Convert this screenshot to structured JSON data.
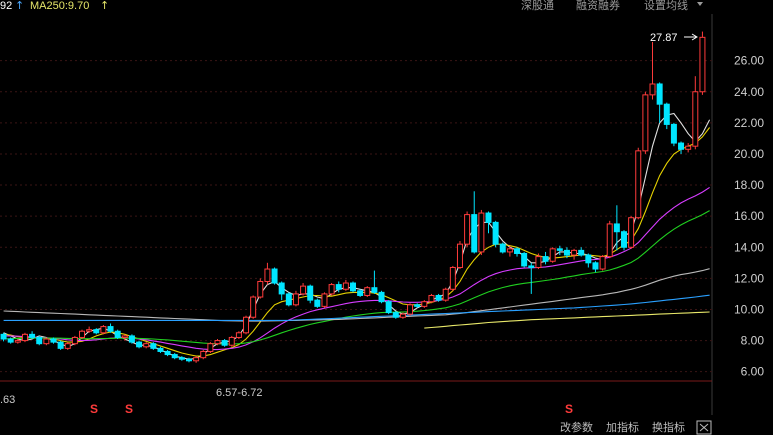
{
  "header": {
    "ma_left": "92",
    "ma_left_arrow": "↑",
    "ma250_label": "MA250:9.70",
    "ma250_arrow": "↑",
    "buttons": [
      "深股通",
      "融资融券",
      "设置均线"
    ]
  },
  "annotations": {
    "peak": "27.87",
    "low_range": "6.57-6.72",
    "left_value": ".63",
    "s_markers": [
      "S",
      "S",
      "S"
    ]
  },
  "footer": {
    "buttons": [
      "改参数",
      "加指标",
      "换指标"
    ]
  },
  "colors": {
    "up": "#ff3b3b",
    "down": "#00e5ff",
    "ma_white": "#e0e0e0",
    "ma_yellow": "#e6d200",
    "ma_purple": "#d63cff",
    "ma_green": "#20d020",
    "ma_gray": "#b8b8b8",
    "ma_cyan": "#2aa0ff",
    "ma_lightyellow": "#e8e86a"
  },
  "chart_data": {
    "type": "candlestick",
    "yaxis_ticks": [
      "26.00",
      "24.00",
      "22.00",
      "20.00",
      "18.00",
      "16.00",
      "14.00",
      "12.00",
      "10.00",
      "8.00",
      "6.00"
    ],
    "ylim": [
      5.4,
      29.0
    ],
    "candles": [
      [
        8.4,
        8.1,
        8.5,
        7.95
      ],
      [
        8.1,
        7.9,
        8.2,
        7.8
      ],
      [
        7.9,
        8.0,
        8.1,
        7.8
      ],
      [
        8.0,
        8.4,
        8.5,
        7.9
      ],
      [
        8.4,
        8.2,
        8.6,
        8.1
      ],
      [
        8.2,
        7.8,
        8.3,
        7.7
      ],
      [
        7.8,
        8.1,
        8.2,
        7.7
      ],
      [
        8.1,
        7.9,
        8.2,
        7.8
      ],
      [
        7.9,
        7.5,
        8.0,
        7.4
      ],
      [
        7.5,
        7.8,
        7.9,
        7.4
      ],
      [
        7.8,
        8.2,
        8.3,
        7.7
      ],
      [
        8.2,
        8.6,
        8.7,
        8.1
      ],
      [
        8.6,
        8.7,
        8.9,
        8.5
      ],
      [
        8.7,
        8.5,
        8.8,
        8.4
      ],
      [
        8.5,
        8.9,
        9.0,
        8.4
      ],
      [
        8.9,
        8.6,
        9.1,
        8.5
      ],
      [
        8.6,
        8.2,
        8.7,
        8.1
      ],
      [
        8.2,
        8.3,
        8.4,
        8.0
      ],
      [
        8.3,
        7.9,
        8.4,
        7.8
      ],
      [
        7.9,
        7.6,
        8.0,
        7.5
      ],
      [
        7.6,
        7.8,
        7.9,
        7.5
      ],
      [
        7.8,
        7.5,
        7.9,
        7.4
      ],
      [
        7.5,
        7.3,
        7.6,
        7.2
      ],
      [
        7.3,
        7.1,
        7.4,
        7.0
      ],
      [
        7.1,
        6.9,
        7.2,
        6.8
      ],
      [
        6.9,
        6.8,
        7.0,
        6.7
      ],
      [
        6.8,
        6.7,
        6.9,
        6.6
      ],
      [
        6.7,
        6.9,
        7.0,
        6.57
      ],
      [
        6.9,
        7.3,
        7.4,
        6.8
      ],
      [
        7.3,
        7.8,
        7.9,
        7.2
      ],
      [
        7.8,
        8.0,
        8.1,
        7.7
      ],
      [
        8.0,
        7.7,
        8.1,
        7.6
      ],
      [
        7.7,
        8.2,
        8.3,
        7.6
      ],
      [
        8.2,
        8.5,
        8.6,
        8.1
      ],
      [
        8.5,
        9.5,
        9.6,
        8.4
      ],
      [
        9.5,
        10.8,
        10.9,
        9.4
      ],
      [
        10.8,
        11.8,
        12.0,
        10.7
      ],
      [
        11.8,
        12.6,
        13.0,
        11.6
      ],
      [
        12.6,
        11.7,
        12.7,
        11.6
      ],
      [
        11.7,
        11.0,
        11.8,
        10.6
      ],
      [
        11.0,
        10.3,
        11.1,
        10.2
      ],
      [
        10.3,
        11.0,
        11.2,
        10.2
      ],
      [
        11.0,
        11.5,
        11.7,
        10.9
      ],
      [
        11.5,
        10.6,
        11.6,
        10.4
      ],
      [
        10.6,
        10.2,
        10.7,
        10.1
      ],
      [
        10.2,
        11.0,
        11.1,
        10.1
      ],
      [
        11.0,
        11.6,
        11.7,
        10.9
      ],
      [
        11.6,
        11.3,
        11.8,
        11.1
      ],
      [
        11.3,
        11.7,
        11.9,
        11.2
      ],
      [
        11.7,
        11.2,
        11.8,
        11.1
      ],
      [
        11.2,
        10.9,
        11.3,
        10.8
      ],
      [
        10.9,
        11.4,
        11.5,
        10.8
      ],
      [
        11.4,
        11.1,
        12.5,
        11.0
      ],
      [
        11.1,
        10.5,
        11.2,
        10.4
      ],
      [
        10.5,
        9.8,
        10.6,
        9.7
      ],
      [
        9.8,
        9.5,
        9.9,
        9.4
      ],
      [
        9.5,
        9.7,
        9.8,
        9.4
      ],
      [
        9.7,
        10.3,
        10.4,
        9.6
      ],
      [
        10.3,
        10.2,
        10.4,
        10.1
      ],
      [
        10.2,
        10.5,
        10.6,
        10.1
      ],
      [
        10.5,
        10.9,
        11.0,
        10.4
      ],
      [
        10.9,
        10.6,
        11.0,
        10.5
      ],
      [
        10.6,
        11.3,
        11.4,
        10.5
      ],
      [
        11.3,
        12.7,
        12.8,
        11.2
      ],
      [
        12.7,
        14.2,
        14.4,
        12.6
      ],
      [
        14.2,
        16.1,
        16.3,
        14.0
      ],
      [
        16.1,
        13.7,
        17.6,
        13.6
      ],
      [
        13.7,
        16.2,
        16.4,
        13.5
      ],
      [
        16.2,
        15.6,
        16.3,
        14.9
      ],
      [
        15.6,
        14.2,
        15.7,
        14.0
      ],
      [
        14.2,
        13.7,
        14.3,
        13.6
      ],
      [
        13.7,
        13.9,
        14.1,
        13.4
      ],
      [
        13.9,
        13.6,
        14.0,
        13.4
      ],
      [
        13.6,
        12.8,
        13.7,
        12.7
      ],
      [
        12.8,
        12.7,
        13.0,
        11.0
      ],
      [
        12.7,
        13.4,
        13.6,
        12.6
      ],
      [
        13.4,
        13.1,
        13.7,
        12.9
      ],
      [
        13.1,
        13.9,
        14.0,
        13.0
      ],
      [
        13.9,
        13.8,
        14.1,
        13.5
      ],
      [
        13.8,
        13.5,
        14.0,
        13.3
      ],
      [
        13.5,
        13.8,
        13.9,
        13.2
      ],
      [
        13.8,
        13.5,
        14.0,
        13.4
      ],
      [
        13.5,
        13.0,
        13.6,
        12.7
      ],
      [
        13.0,
        12.6,
        13.1,
        12.4
      ],
      [
        12.6,
        13.4,
        13.5,
        12.5
      ],
      [
        13.4,
        15.5,
        15.7,
        13.3
      ],
      [
        15.5,
        15.0,
        16.7,
        13.8
      ],
      [
        15.0,
        14.0,
        15.1,
        13.8
      ],
      [
        14.0,
        15.9,
        16.0,
        13.9
      ],
      [
        15.9,
        20.2,
        20.4,
        15.8
      ],
      [
        20.2,
        23.8,
        24.0,
        20.0
      ],
      [
        23.8,
        24.5,
        27.2,
        23.5
      ],
      [
        24.5,
        23.2,
        24.6,
        22.0
      ],
      [
        23.2,
        21.9,
        23.3,
        21.6
      ],
      [
        21.9,
        20.7,
        22.0,
        20.5
      ],
      [
        20.7,
        20.3,
        20.8,
        20.0
      ],
      [
        20.3,
        20.5,
        20.7,
        20.1
      ],
      [
        20.5,
        24.0,
        25.0,
        20.3
      ],
      [
        24.0,
        27.5,
        27.87,
        23.8
      ]
    ],
    "ma_series": [
      {
        "color_key": "ma_white",
        "values": [
          8.5,
          8.3,
          8.1,
          8.0,
          8.1,
          8.3,
          8.2,
          8.0,
          7.8,
          7.6,
          7.8,
          8.2,
          8.6,
          8.7,
          8.8,
          8.6,
          8.3,
          8.1,
          7.9,
          7.7,
          7.7,
          7.6,
          7.4,
          7.2,
          7.0,
          6.9,
          6.8,
          6.85,
          7.1,
          7.5,
          7.8,
          7.9,
          8.0,
          8.3,
          9.0,
          10.0,
          11.0,
          11.6,
          11.8,
          11.4,
          11.1,
          10.9,
          11.0,
          11.0,
          10.8,
          10.7,
          11.0,
          11.3,
          11.4,
          11.4,
          11.3,
          11.2,
          11.1,
          10.8,
          10.3,
          9.9,
          9.7,
          9.8,
          10.1,
          10.3,
          10.6,
          10.8,
          11.0,
          11.8,
          13.0,
          14.5,
          15.2,
          15.6,
          15.6,
          15.0,
          14.4,
          14.0,
          13.8,
          13.4,
          13.0,
          13.0,
          13.1,
          13.4,
          13.7,
          13.7,
          13.6,
          13.6,
          13.5,
          13.3,
          13.2,
          13.6,
          14.3,
          14.7,
          15.0,
          16.5,
          18.5,
          20.5,
          22.0,
          22.5,
          22.6,
          22.0,
          21.3,
          20.8,
          21.3,
          22.2
        ]
      },
      {
        "color_key": "ma_yellow",
        "values": [
          8.4,
          8.35,
          8.25,
          8.2,
          8.2,
          8.2,
          8.15,
          8.1,
          8.0,
          7.9,
          7.9,
          7.95,
          8.1,
          8.3,
          8.45,
          8.55,
          8.5,
          8.4,
          8.25,
          8.1,
          7.95,
          7.8,
          7.65,
          7.5,
          7.35,
          7.2,
          7.1,
          7.0,
          7.0,
          7.1,
          7.25,
          7.4,
          7.55,
          7.75,
          8.1,
          8.6,
          9.2,
          9.8,
          10.3,
          10.5,
          10.6,
          10.7,
          10.8,
          10.9,
          10.9,
          10.85,
          10.85,
          10.95,
          11.05,
          11.1,
          11.1,
          11.1,
          11.05,
          10.95,
          10.75,
          10.55,
          10.35,
          10.3,
          10.3,
          10.35,
          10.45,
          10.6,
          10.8,
          11.2,
          11.8,
          12.6,
          13.2,
          13.7,
          14.0,
          14.2,
          14.2,
          14.1,
          14.0,
          13.8,
          13.6,
          13.45,
          13.35,
          13.3,
          13.35,
          13.4,
          13.45,
          13.5,
          13.5,
          13.45,
          13.4,
          13.55,
          13.85,
          14.15,
          14.45,
          15.2,
          16.3,
          17.5,
          18.6,
          19.4,
          20.0,
          20.3,
          20.5,
          20.7,
          21.1,
          21.7
        ]
      },
      {
        "color_key": "ma_purple",
        "values": [
          8.3,
          8.3,
          8.28,
          8.25,
          8.22,
          8.2,
          8.18,
          8.15,
          8.1,
          8.05,
          8.02,
          8.0,
          8.02,
          8.05,
          8.1,
          8.15,
          8.18,
          8.18,
          8.15,
          8.1,
          8.05,
          7.98,
          7.9,
          7.82,
          7.74,
          7.66,
          7.58,
          7.5,
          7.45,
          7.42,
          7.42,
          7.45,
          7.5,
          7.58,
          7.72,
          7.92,
          8.18,
          8.48,
          8.8,
          9.08,
          9.32,
          9.52,
          9.7,
          9.86,
          9.98,
          10.08,
          10.18,
          10.28,
          10.38,
          10.46,
          10.52,
          10.56,
          10.58,
          10.58,
          10.56,
          10.52,
          10.48,
          10.46,
          10.46,
          10.48,
          10.52,
          10.58,
          10.66,
          10.8,
          11.0,
          11.3,
          11.6,
          11.88,
          12.12,
          12.3,
          12.44,
          12.54,
          12.62,
          12.66,
          12.68,
          12.7,
          12.74,
          12.8,
          12.88,
          12.96,
          13.04,
          13.12,
          13.18,
          13.22,
          13.26,
          13.36,
          13.52,
          13.72,
          13.94,
          14.3,
          14.8,
          15.3,
          15.8,
          16.2,
          16.55,
          16.85,
          17.1,
          17.3,
          17.55,
          17.85
        ]
      },
      {
        "color_key": "ma_green",
        "values": [
          8.1,
          8.12,
          8.14,
          8.15,
          8.16,
          8.16,
          8.16,
          8.16,
          8.15,
          8.14,
          8.13,
          8.12,
          8.12,
          8.12,
          8.13,
          8.14,
          8.15,
          8.15,
          8.15,
          8.14,
          8.12,
          8.1,
          8.07,
          8.04,
          8.0,
          7.96,
          7.92,
          7.88,
          7.84,
          7.81,
          7.79,
          7.78,
          7.78,
          7.8,
          7.85,
          7.93,
          8.04,
          8.18,
          8.34,
          8.5,
          8.65,
          8.79,
          8.92,
          9.04,
          9.14,
          9.23,
          9.32,
          9.41,
          9.5,
          9.58,
          9.65,
          9.71,
          9.76,
          9.8,
          9.82,
          9.83,
          9.84,
          9.86,
          9.89,
          9.93,
          9.98,
          10.04,
          10.11,
          10.22,
          10.36,
          10.55,
          10.75,
          10.95,
          11.13,
          11.28,
          11.41,
          11.52,
          11.61,
          11.68,
          11.74,
          11.8,
          11.86,
          11.93,
          12.0,
          12.08,
          12.16,
          12.24,
          12.31,
          12.38,
          12.44,
          12.54,
          12.68,
          12.84,
          13.02,
          13.3,
          13.68,
          14.08,
          14.48,
          14.84,
          15.16,
          15.44,
          15.68,
          15.88,
          16.1,
          16.36
        ]
      },
      {
        "color_key": "ma_gray",
        "values": [
          9.9,
          9.88,
          9.86,
          9.84,
          9.82,
          9.8,
          9.78,
          9.76,
          9.74,
          9.72,
          9.7,
          9.68,
          9.66,
          9.64,
          9.62,
          9.6,
          9.58,
          9.56,
          9.54,
          9.52,
          9.5,
          9.48,
          9.46,
          9.44,
          9.42,
          9.4,
          9.38,
          9.36,
          9.34,
          9.32,
          9.3,
          9.28,
          9.27,
          9.26,
          9.25,
          9.25,
          9.25,
          9.26,
          9.27,
          9.28,
          9.29,
          9.3,
          9.31,
          9.32,
          9.33,
          9.34,
          9.35,
          9.36,
          9.38,
          9.4,
          9.42,
          9.44,
          9.46,
          9.48,
          9.5,
          9.52,
          9.54,
          9.56,
          9.58,
          9.6,
          9.62,
          9.64,
          9.66,
          9.7,
          9.74,
          9.8,
          9.86,
          9.92,
          9.98,
          10.04,
          10.1,
          10.16,
          10.22,
          10.28,
          10.34,
          10.4,
          10.46,
          10.52,
          10.58,
          10.64,
          10.7,
          10.76,
          10.82,
          10.88,
          10.94,
          11.02,
          11.1,
          11.2,
          11.3,
          11.42,
          11.56,
          11.72,
          11.88,
          12.02,
          12.14,
          12.24,
          12.32,
          12.4,
          12.5,
          12.62
        ]
      },
      {
        "color_key": "ma_cyan",
        "values": [
          9.3,
          9.3,
          9.3,
          9.3,
          9.3,
          9.3,
          9.3,
          9.3,
          9.3,
          9.3,
          9.3,
          9.3,
          9.3,
          9.3,
          9.3,
          9.3,
          9.3,
          9.3,
          9.3,
          9.3,
          9.3,
          9.3,
          9.3,
          9.3,
          9.3,
          9.3,
          9.3,
          9.3,
          9.3,
          9.3,
          9.3,
          9.3,
          9.3,
          9.3,
          9.3,
          9.3,
          9.3,
          9.3,
          9.3,
          9.3,
          9.3,
          9.32,
          9.34,
          9.36,
          9.38,
          9.4,
          9.42,
          9.44,
          9.46,
          9.48,
          9.5,
          9.52,
          9.54,
          9.56,
          9.58,
          9.6,
          9.62,
          9.64,
          9.66,
          9.68,
          9.7,
          9.72,
          9.74,
          9.76,
          9.78,
          9.8,
          9.82,
          9.84,
          9.86,
          9.88,
          9.9,
          9.92,
          9.94,
          9.96,
          9.98,
          10.0,
          10.02,
          10.04,
          10.06,
          10.08,
          10.1,
          10.13,
          10.16,
          10.19,
          10.22,
          10.25,
          10.28,
          10.32,
          10.36,
          10.4,
          10.45,
          10.5,
          10.55,
          10.6,
          10.65,
          10.7,
          10.75,
          10.8,
          10.86,
          10.92
        ]
      },
      {
        "color_key": "ma_lightyellow",
        "values": [
          null,
          null,
          null,
          null,
          null,
          null,
          null,
          null,
          null,
          null,
          null,
          null,
          null,
          null,
          null,
          null,
          null,
          null,
          null,
          null,
          null,
          null,
          null,
          null,
          null,
          null,
          null,
          null,
          null,
          null,
          null,
          null,
          null,
          null,
          null,
          null,
          null,
          null,
          null,
          null,
          null,
          null,
          null,
          null,
          null,
          null,
          null,
          null,
          null,
          null,
          null,
          null,
          null,
          null,
          null,
          null,
          null,
          null,
          null,
          8.8,
          8.84,
          8.88,
          8.92,
          8.96,
          9.0,
          9.04,
          9.08,
          9.12,
          9.16,
          9.19,
          9.22,
          9.25,
          9.28,
          9.31,
          9.34,
          9.36,
          9.38,
          9.4,
          9.42,
          9.44,
          9.46,
          9.48,
          9.5,
          9.52,
          9.54,
          9.56,
          9.58,
          9.6,
          9.62,
          9.64,
          9.66,
          9.68,
          9.7,
          9.72,
          9.74,
          9.76,
          9.78,
          9.8,
          9.82,
          9.84
        ]
      }
    ]
  }
}
